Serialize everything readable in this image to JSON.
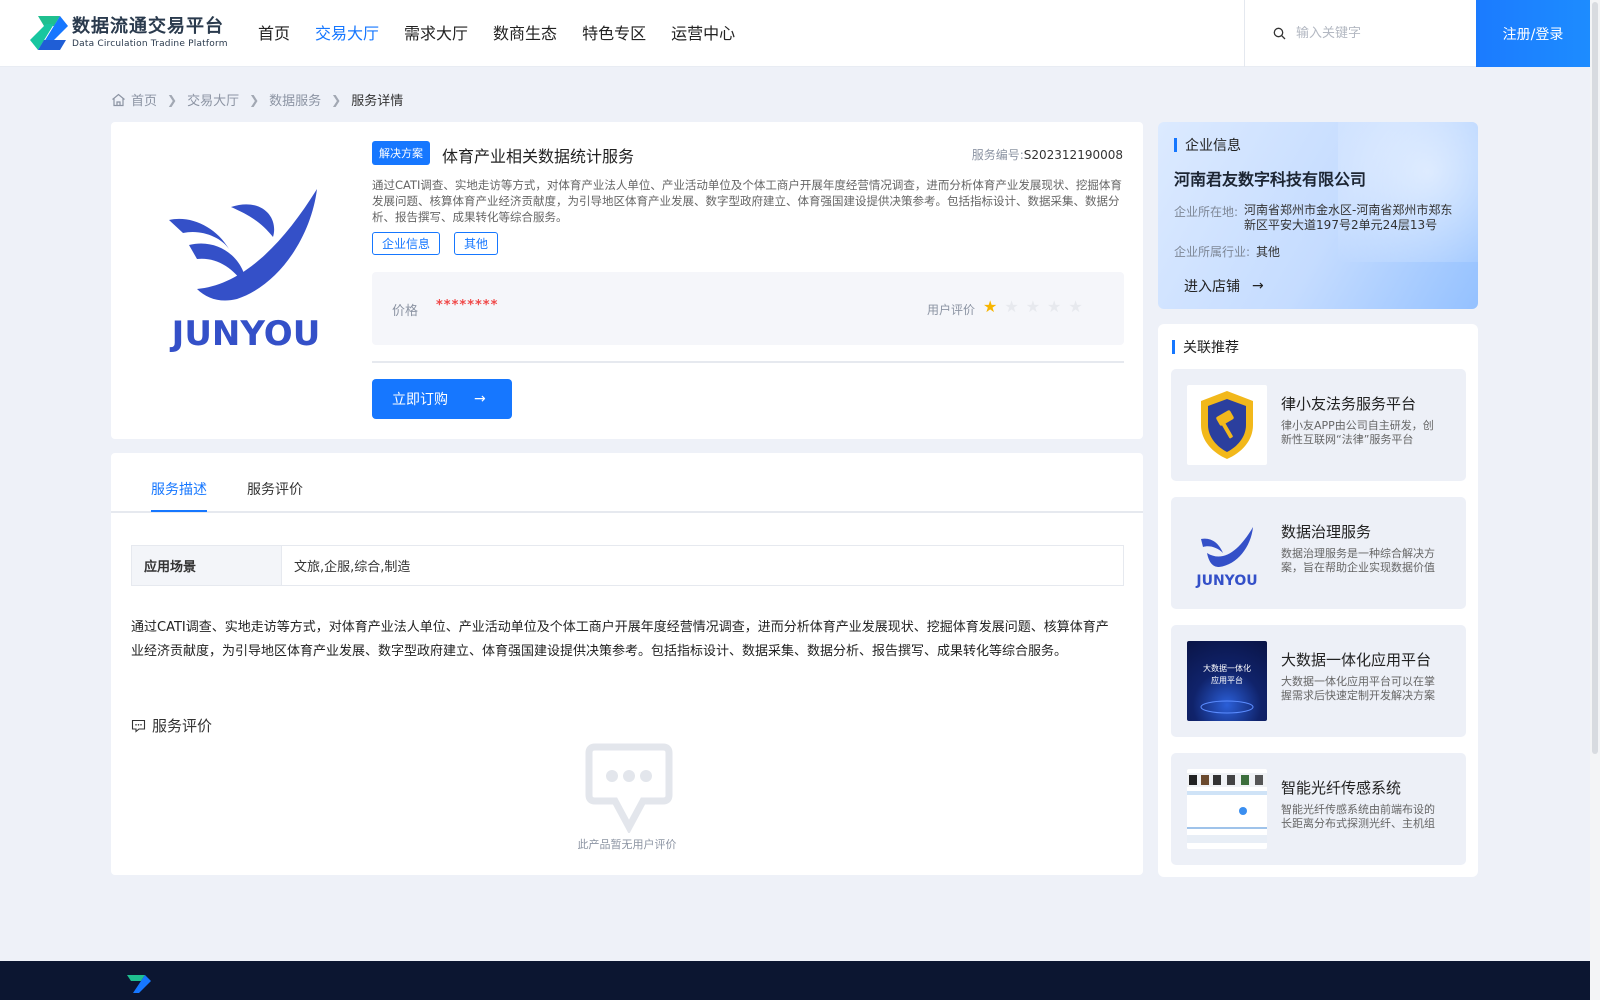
{
  "header": {
    "logo_cn": "数据流通交易平台",
    "logo_en": "Data Circulation Tradine Platform",
    "nav": [
      {
        "label": "首页",
        "active": false
      },
      {
        "label": "交易大厅",
        "active": true
      },
      {
        "label": "需求大厅",
        "active": false
      },
      {
        "label": "数商生态",
        "active": false
      },
      {
        "label": "特色专区",
        "active": false
      },
      {
        "label": "运营中心",
        "active": false
      }
    ],
    "search_placeholder": "输入关键字",
    "login_label": "注册/登录"
  },
  "breadcrumb": [
    "首页",
    "交易大厅",
    "数据服务",
    "服务详情"
  ],
  "product": {
    "logo_text": "JUNYOU",
    "tag": "解决方案",
    "title": "体育产业相关数据统计服务",
    "service_no_label": "服务编号:",
    "service_no": "S202312190008",
    "description": "通过CATI调查、实地走访等方式，对体育产业法人单位、产业活动单位及个体工商户开展年度经营情况调查，进而分析体育产业发展现状、挖掘体育发展问题、核算体育产业经济贡献度，为引导地区体育产业发展、数字型政府建立、体育强国建设提供决策参考。包括指标设计、数据采集、数据分析、报告撰写、成果转化等综合服务。",
    "chips": [
      "企业信息",
      "其他"
    ],
    "price_label": "价格",
    "price_value": "********",
    "rating_label": "用户评价",
    "rating": 1,
    "rating_max": 5,
    "buy_label": "立即订购"
  },
  "tabs": [
    {
      "label": "服务描述",
      "active": true
    },
    {
      "label": "服务评价",
      "active": false
    }
  ],
  "scene": {
    "label": "应用场景",
    "value": "文旅,企服,综合,制造"
  },
  "long_description": "通过CATI调查、实地走访等方式，对体育产业法人单位、产业活动单位及个体工商户开展年度经营情况调查，进而分析体育产业发展现状、挖掘体育发展问题、核算体育产业经济贡献度，为引导地区体育产业发展、数字型政府建立、体育强国建设提供决策参考。包括指标设计、数据采集、数据分析、报告撰写、成果转化等综合服务。",
  "reviews": {
    "title": "服务评价",
    "empty_text": "此产品暂无用户评价"
  },
  "company": {
    "section_title": "企业信息",
    "name": "河南君友数字科技有限公司",
    "location_label": "企业所在地:",
    "location": "河南省郑州市金水区-河南省郑州市郑东新区平安大道197号2单元24层13号",
    "industry_label": "企业所属行业:",
    "industry": "其他",
    "shop_label": "进入店铺"
  },
  "related": {
    "section_title": "关联推荐",
    "items": [
      {
        "title": "律小友法务服务平台",
        "desc": "律小友APP由公司自主研发，创新性互联网“法律”服务平台",
        "thumb": "shield-logo"
      },
      {
        "title": "数据治理服务",
        "desc": "数据治理服务是一种综合解决方案，旨在帮助企业实现数据价值",
        "thumb": "junyou-logo"
      },
      {
        "title": "大数据一体化应用平台",
        "desc": "大数据一体化应用平台可以在掌握需求后快速定制开发解决方案",
        "thumb": "bigdata-platform"
      },
      {
        "title": "智能光纤传感系统",
        "desc": "智能光纤传感系统由前端布设的长距离分布式探测光纤、主机组成",
        "thumb": "fiber-system"
      }
    ],
    "thumb_texts": {
      "bigdata_line1": "大数据一体化",
      "bigdata_line2": "应用平台"
    }
  },
  "colors": {
    "accent": "#1677ff",
    "price": "#f04848",
    "star": "#f7b500",
    "footer": "#0c1631"
  }
}
